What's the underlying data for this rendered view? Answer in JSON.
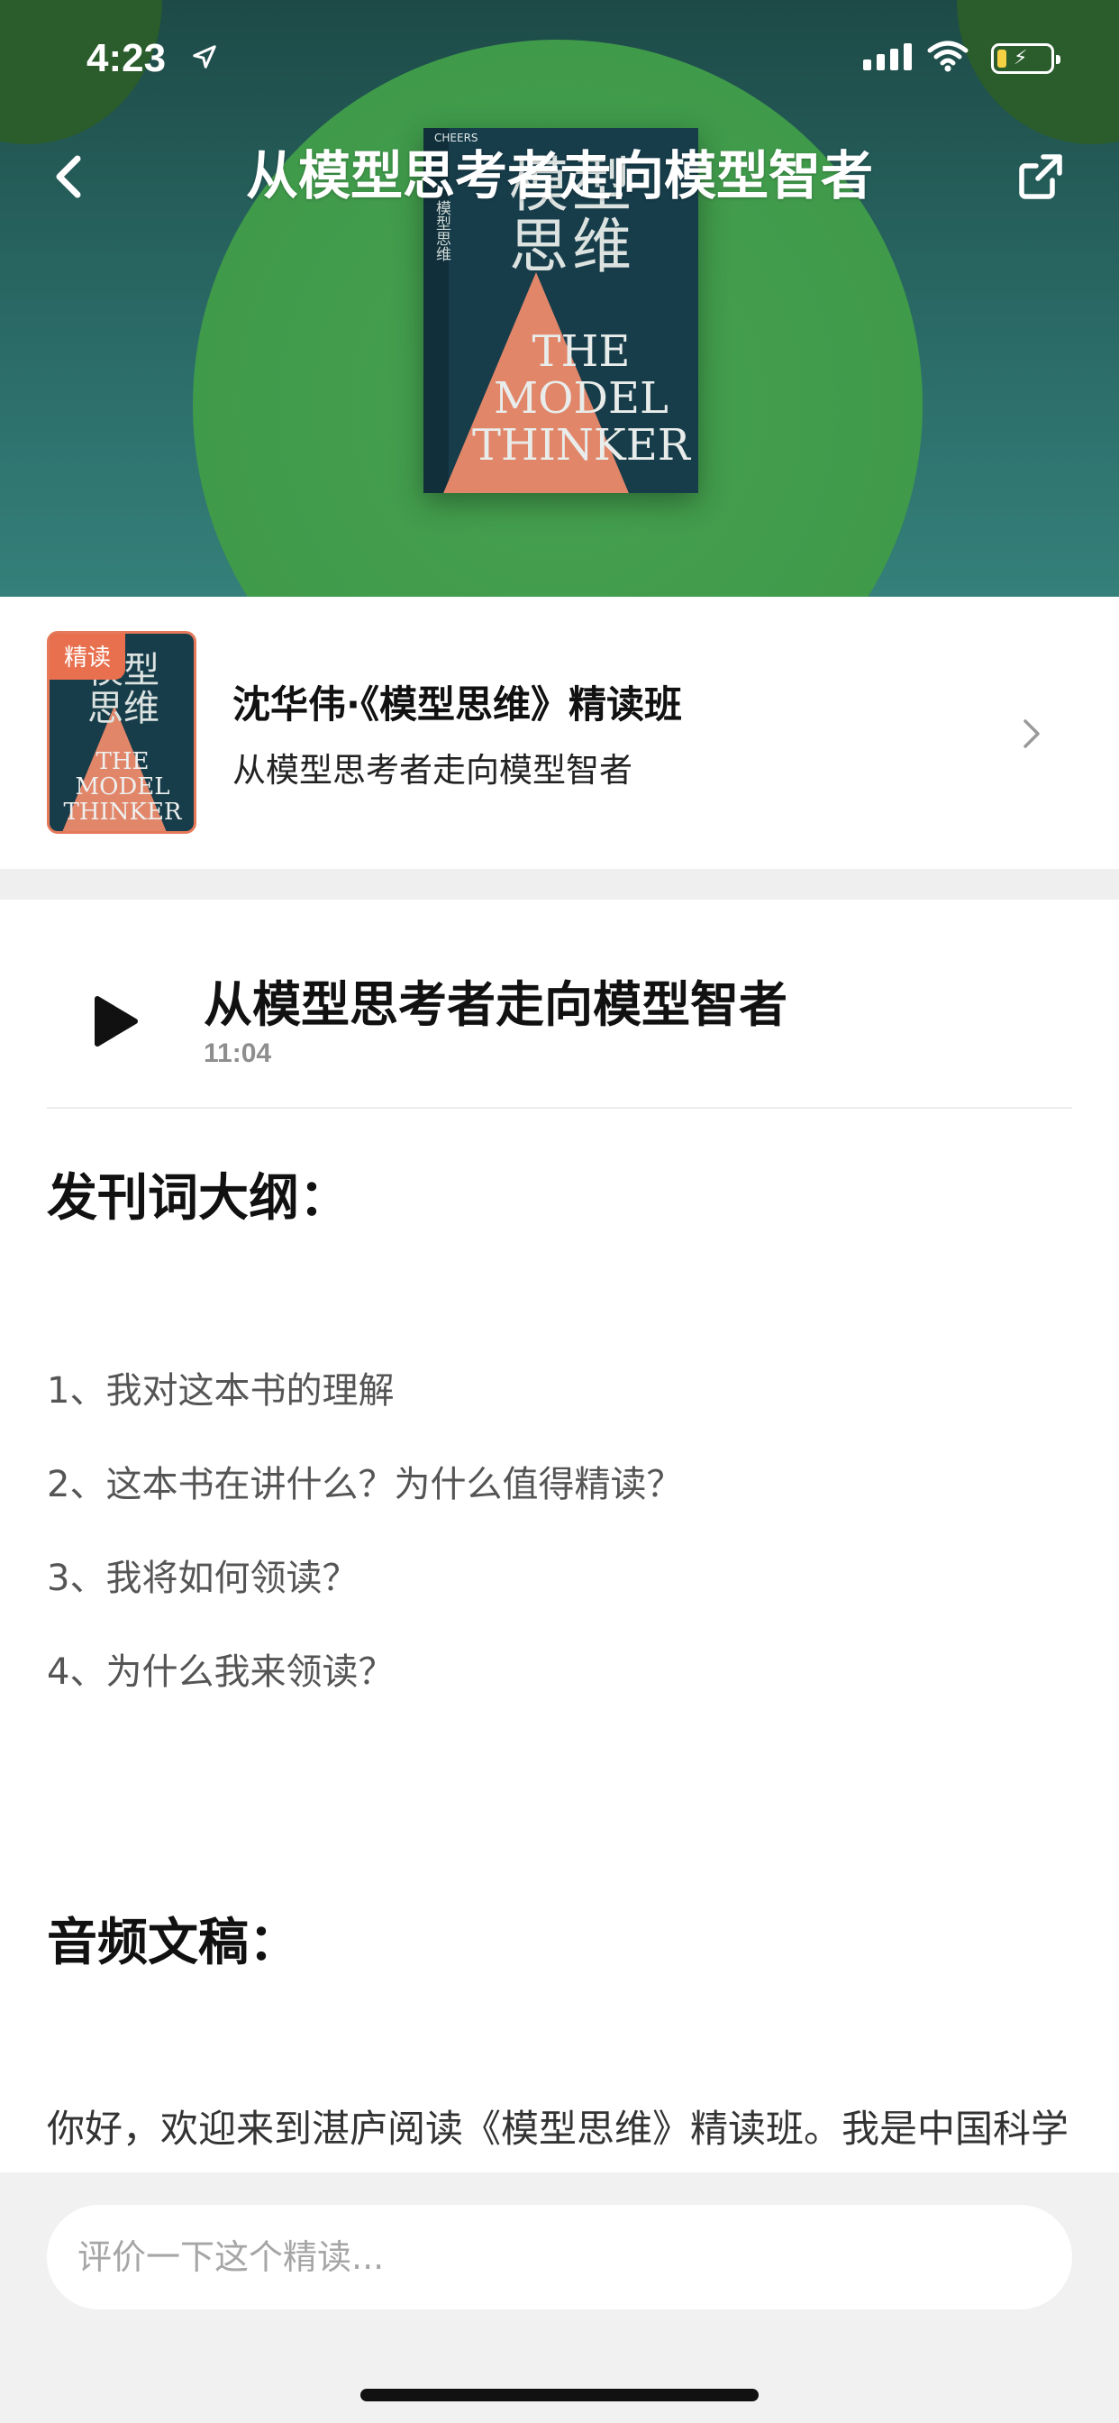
{
  "status_bar": {
    "time": "4:23"
  },
  "header": {
    "title": "从模型思考者走向模型智者"
  },
  "cover": {
    "publisher": "CHEERS",
    "cn_title": "模型\n思维",
    "spine_title": "模型思维",
    "en_title": "THE\nMODEL\nTHINKER"
  },
  "course": {
    "tag": "精读",
    "thumb_cn": "模型\n思维",
    "thumb_en": "THE\nMODEL\nTHINKER",
    "name": "沈华伟·《模型思维》精读班",
    "subtitle": "从模型思考者走向模型智者"
  },
  "audio": {
    "title": "从模型思考者走向模型智者",
    "duration": "11:04"
  },
  "outline": {
    "heading": "发刊词大纲：",
    "items": [
      "1、我对这本书的理解",
      "2、这本书在讲什么？为什么值得精读？",
      "3、我将如何领读？",
      "4、为什么我来领读？"
    ]
  },
  "transcript": {
    "heading": "音频文稿：",
    "first_line": "你好，欢迎来到湛庐阅读《模型思维》精读班。我是中国科学"
  },
  "comment": {
    "placeholder": "评价一下这个精读..."
  },
  "colors": {
    "hero_green": "#3f9a4a",
    "hero_teal": "#2a6a66",
    "tag_orange": "#e8704e",
    "cover_navy": "#173d4a",
    "cover_salmon": "#e2866a"
  }
}
